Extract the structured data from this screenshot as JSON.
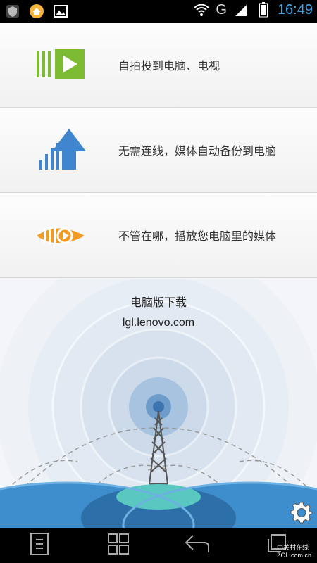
{
  "status_bar": {
    "network": "G",
    "time": "16:49",
    "icons": [
      "shield-app-icon",
      "home-app-icon",
      "image-icon",
      "wifi-icon",
      "signal-icon",
      "battery-icon"
    ]
  },
  "features": [
    {
      "icon": "play-cast-icon",
      "label": "自拍投到电脑、电视"
    },
    {
      "icon": "upload-arrow-icon",
      "label": "无需连线，媒体自动备份到电脑"
    },
    {
      "icon": "eye-play-icon",
      "label": "不管在哪，播放您电脑里的媒体"
    }
  ],
  "download": {
    "title": "电脑版下载",
    "url": "lgl.lenovo.com"
  },
  "nav_bar": {
    "buttons": [
      "menu-icon",
      "apps-grid-icon",
      "back-icon",
      "recent-apps-icon"
    ]
  },
  "watermark": {
    "line1": "中关村在线",
    "line2": "ZOL.com.cn"
  },
  "colors": {
    "green": "#7cbb33",
    "blue": "#3f86cf",
    "orange": "#f39a23",
    "time": "#3ea7e6"
  }
}
